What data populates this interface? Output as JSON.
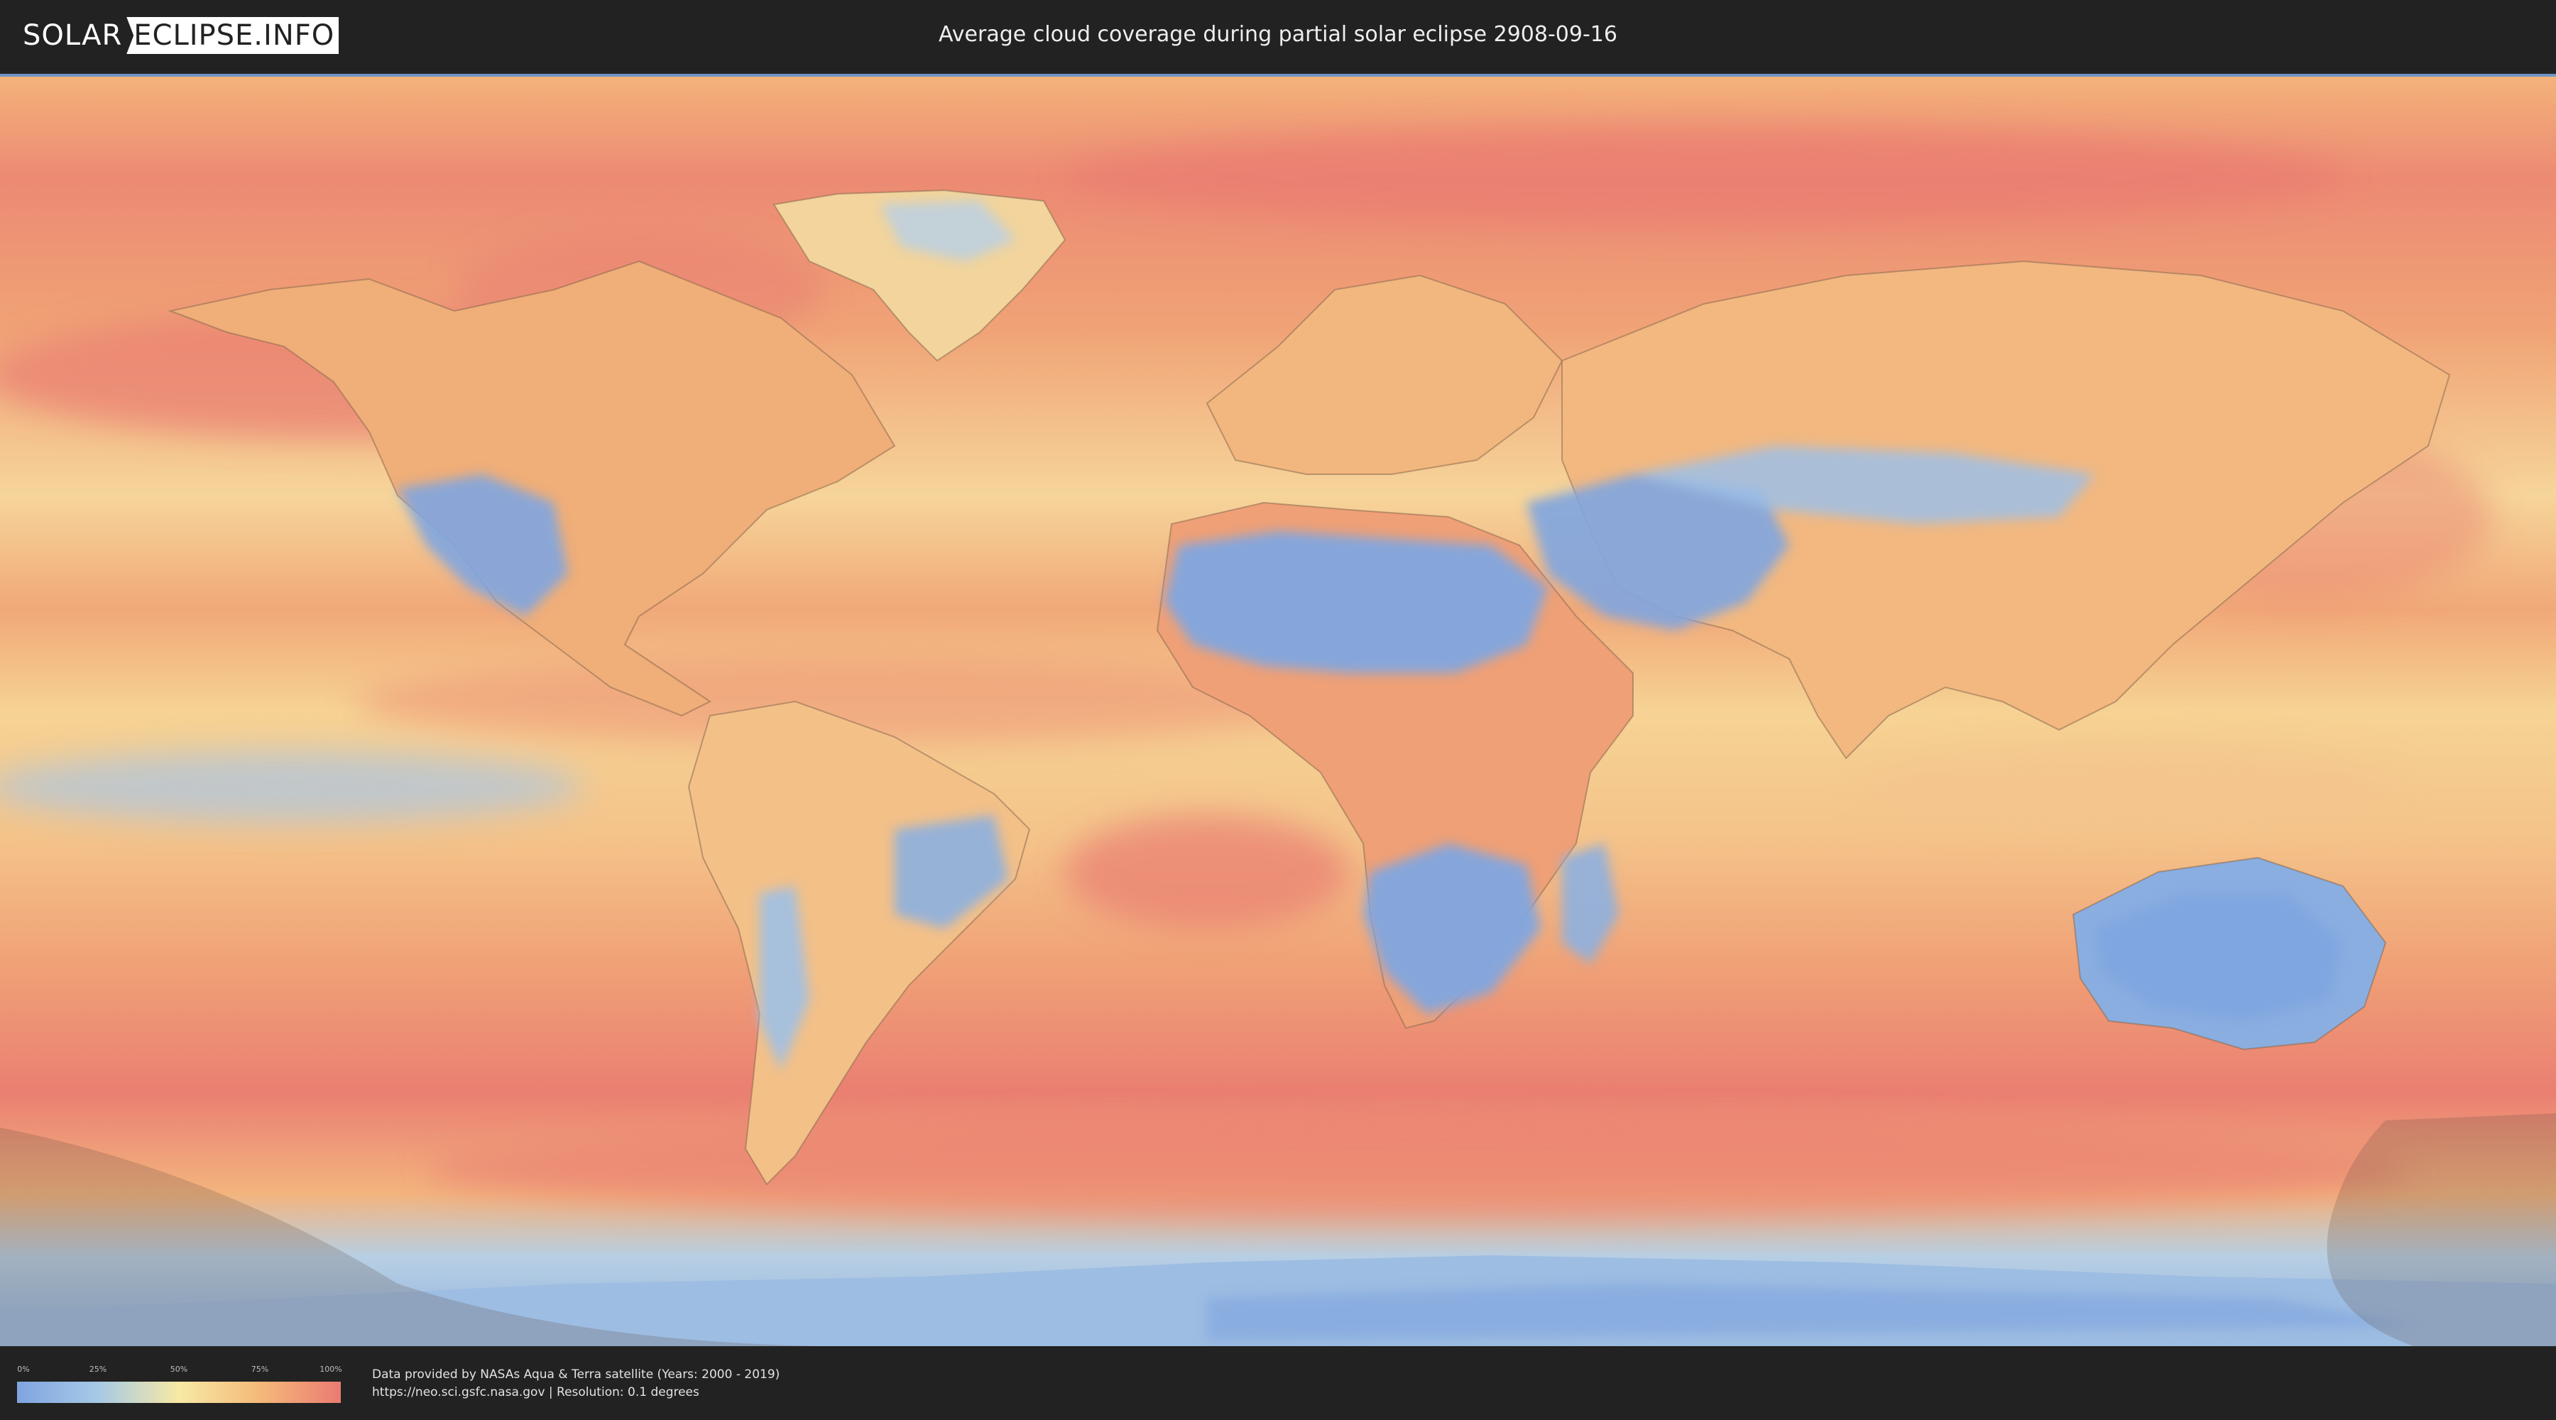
{
  "header": {
    "logo_part1": "SOLAR",
    "logo_part2": "ECLIPSE.INFO",
    "title": "Average cloud coverage during partial solar eclipse 2908-09-16"
  },
  "legend": {
    "ticks": [
      "0%",
      "25%",
      "50%",
      "75%",
      "100%"
    ],
    "colors": [
      "#7fa5e0",
      "#a6c9e6",
      "#f7e9a5",
      "#f5b979",
      "#ea7b72"
    ]
  },
  "footer": {
    "credit_line1": "Data provided by NASAs Aqua & Terra satellite (Years: 2000 - 2019)",
    "credit_line2": "https://neo.sci.gsfc.nasa.gov | Resolution: 0.1 degrees"
  },
  "map": {
    "colors": {
      "clear": "#7fa5e0",
      "low": "#a6c9e6",
      "mid": "#f7e9a5",
      "high": "#f5b979",
      "overcast": "#ea7b72",
      "border": "#8a6a50"
    }
  }
}
